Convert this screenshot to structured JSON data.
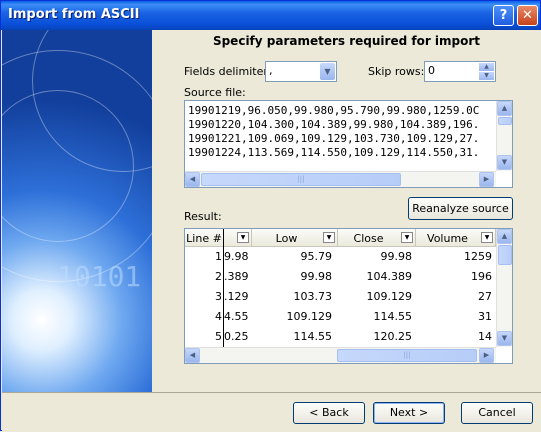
{
  "window": {
    "title": "Import from ASCII",
    "help_label": "?",
    "close_label": "✕"
  },
  "side": {
    "decor_text": "10101"
  },
  "heading": "Specify parameters required for import",
  "fields_delimiter": {
    "label": "Fields delimiter:",
    "value": ","
  },
  "skip_rows": {
    "label": "Skip rows:",
    "value": "0"
  },
  "source_file": {
    "label": "Source file:",
    "lines": [
      "19901219,96.050,99.980,95.790,99.980,1259.0C",
      "19901220,104.300,104.389,99.980,104.389,196.",
      "19901221,109.069,109.129,103.730,109.129,27.",
      "19901224,113.569,114.550,109.129,114.550,31."
    ]
  },
  "reanalyze_label": "Reanalyze source",
  "result": {
    "label": "Result:",
    "columns": [
      "Line #",
      "",
      "Low",
      "Close",
      "Volume"
    ],
    "rows": [
      [
        "1",
        "9.98",
        "95.79",
        "99.98",
        "1259"
      ],
      [
        "2",
        ".389",
        "99.98",
        "104.389",
        "196"
      ],
      [
        "3",
        ".129",
        "103.73",
        "109.129",
        "27"
      ],
      [
        "4",
        "4.55",
        "109.129",
        "114.55",
        "31"
      ],
      [
        "5",
        "0.25",
        "114.55",
        "120.25",
        "14"
      ]
    ]
  },
  "buttons": {
    "back": "< Back",
    "next": "Next >",
    "cancel": "Cancel"
  },
  "colors": {
    "title_bar": "#0a4fd8",
    "button_border": "#003c74"
  }
}
